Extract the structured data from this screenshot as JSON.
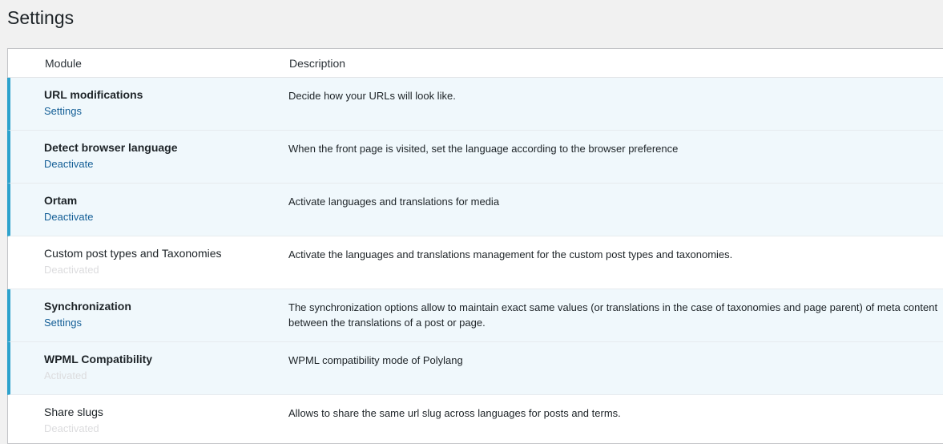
{
  "page": {
    "title": "Settings"
  },
  "table": {
    "headers": {
      "module": "Module",
      "description": "Description"
    },
    "rows": [
      {
        "name": "URL modifications",
        "action": "Settings",
        "description": "Decide how your URLs will look like."
      },
      {
        "name": "Detect browser language",
        "action": "Deactivate",
        "description": "When the front page is visited, set the language according to the browser preference"
      },
      {
        "name": "Ortam",
        "action": "Deactivate",
        "description": "Activate languages and translations for media"
      },
      {
        "name": "Custom post types and Taxonomies",
        "status": "Deactivated",
        "description": "Activate the languages and translations management for the custom post types and taxonomies."
      },
      {
        "name": "Synchronization",
        "action": "Settings",
        "description": "The synchronization options allow to maintain exact same values (or translations in the case of taxonomies and page parent) of meta content between the translations of a post or page."
      },
      {
        "name": "WPML Compatibility",
        "status": "Activated",
        "description": "WPML compatibility mode of Polylang"
      },
      {
        "name": "Share slugs",
        "status": "Deactivated",
        "description": "Allows to share the same url slug across languages for posts and terms."
      }
    ]
  },
  "colors": {
    "active_border": "#2ea2cc",
    "active_background": "#f0f8fc",
    "link": "#135e96",
    "muted_status": "#dcdcde"
  }
}
